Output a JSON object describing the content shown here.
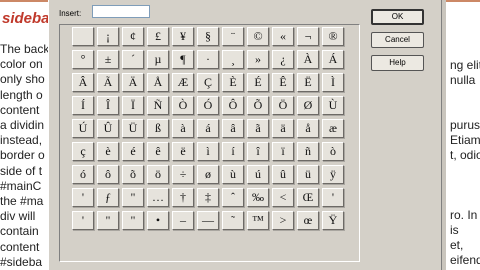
{
  "background": {
    "heading": "sidebar",
    "left_lines": [
      "The back",
      "color on",
      "only sho",
      "length o",
      "content",
      "a dividin",
      "instead,",
      "border o",
      "side of t",
      "#mainC",
      "the #ma",
      "div will",
      "contain",
      "content",
      "#sideba"
    ],
    "right_lines": [
      "ng elit.",
      "nulla",
      "purus",
      "Etiam",
      "t, odio.",
      "ro. In",
      "is",
      "et,",
      "eifend"
    ]
  },
  "dialog": {
    "insert_label": "Insert:",
    "insert_value": "",
    "buttons": {
      "ok": "OK",
      "cancel": "Cancel",
      "help": "Help"
    },
    "characters": [
      "",
      "¡",
      "¢",
      "£",
      "¥",
      "§",
      "¨",
      "©",
      "«",
      "¬",
      "®",
      "°",
      "±",
      "´",
      "µ",
      "¶",
      "·",
      "¸",
      "»",
      "¿",
      "À",
      "Á",
      "Â",
      "Ã",
      "Ä",
      "Å",
      "Æ",
      "Ç",
      "È",
      "É",
      "Ê",
      "Ë",
      "Ì",
      "Í",
      "Î",
      "Ï",
      "Ñ",
      "Ò",
      "Ó",
      "Ô",
      "Õ",
      "Ö",
      "Ø",
      "Ù",
      "Ú",
      "Û",
      "Ü",
      "ß",
      "à",
      "á",
      "â",
      "ã",
      "ä",
      "å",
      "æ",
      "ç",
      "è",
      "é",
      "ê",
      "ë",
      "ì",
      "í",
      "î",
      "ï",
      "ñ",
      "ò",
      "ó",
      "ô",
      "õ",
      "ö",
      "÷",
      "ø",
      "ù",
      "ú",
      "û",
      "ü",
      "ÿ",
      "'",
      "ƒ",
      "\"",
      "…",
      "†",
      "‡",
      "ˆ",
      "‰",
      "<",
      "Œ",
      "'",
      "'",
      "\"",
      "\"",
      "•",
      "–",
      "—",
      "˜",
      "™",
      ">",
      "œ",
      "Ÿ"
    ]
  }
}
